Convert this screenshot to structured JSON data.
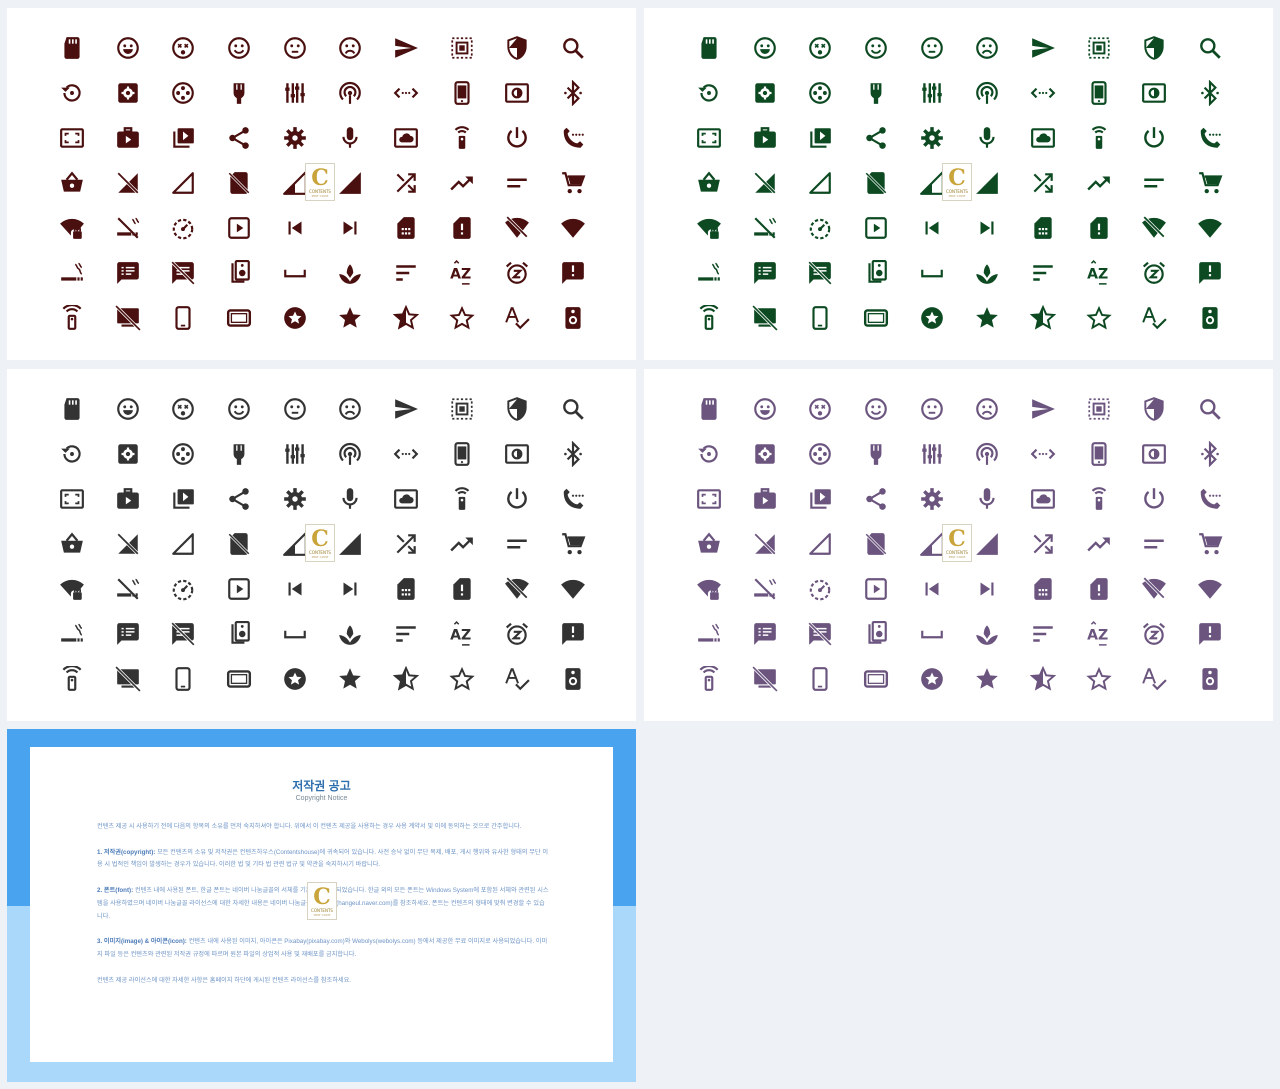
{
  "slides": [
    {
      "name": "icons-maroon",
      "color": "#4a0f0f"
    },
    {
      "name": "icons-green",
      "color": "#0d4a22"
    },
    {
      "name": "icons-charcoal",
      "color": "#333333"
    },
    {
      "name": "icons-purple",
      "color": "#6b557f"
    }
  ],
  "icon_grid": {
    "rows": [
      [
        "sd-card-icon",
        "smile-grin-icon",
        "dizzy-face-icon",
        "smile-icon",
        "neutral-face-icon",
        "sad-face-icon",
        "send-icon",
        "select-all-icon",
        "shield-icon",
        "search-icon"
      ],
      [
        "restore-icon",
        "settings-box-icon",
        "film-reel-icon",
        "power-plug-icon",
        "equalizer-icon",
        "wifi-tethering-icon",
        "code-arrows-icon",
        "smartphone-icon",
        "brightness-box-icon",
        "bluetooth-icon"
      ],
      [
        "fullscreen-box-icon",
        "video-case-icon",
        "video-library-icon",
        "share-icon",
        "gear-icon",
        "microphone-icon",
        "cloud-box-icon",
        "remote-icon",
        "power-icon",
        "call-dots-icon"
      ],
      [
        "basket-icon",
        "signal-off-icon",
        "signal-empty-icon",
        "sim-off-icon",
        "signal-half-icon",
        "signal-full-icon",
        "shuffle-icon",
        "trending-up-icon",
        "short-text-icon",
        "cart-icon"
      ],
      [
        "wifi-lock-icon",
        "no-smoking-icon",
        "timer-dial-icon",
        "slideshow-icon",
        "skip-previous-icon",
        "skip-next-icon",
        "sim-card-icon",
        "sim-alert-icon",
        "wifi-off-icon",
        "wifi-full-icon"
      ],
      [
        "smoking-icon",
        "message-list-icon",
        "comment-off-icon",
        "speaker-group-icon",
        "space-bar-icon",
        "spa-icon",
        "sort-lines-icon",
        "sort-az-icon",
        "snooze-alarm-icon",
        "feedback-icon"
      ],
      [
        "tower-icon",
        "desktop-off-icon",
        "phone-outline-icon",
        "tablet-landscape-icon",
        "stars-icon",
        "star-icon",
        "star-half-icon",
        "star-outline-icon",
        "spellcheck-icon",
        "speaker-icon"
      ]
    ]
  },
  "watermark": {
    "letter": "C",
    "text": "CONTENTS",
    "sub": "PPAT CODE"
  },
  "notice": {
    "title": "저작권 공고",
    "subtitle": "Copyright Notice",
    "intro": "컨텐츠 제공 시 사용하기 전에 다음의 항목의 소유를 먼저 숙지하셔야 합니다. 위에서 이 컨텐츠 제공을 사용하는 경우 사용 계약서 및 이에 동의하는 것으로 간주합니다.",
    "p1_head": "1. 저작권(copyright):",
    "p1_body": "모든 컨텐츠의 소유 및 저작권은 컨텐츠하우스(Contentshouse)에 귀속되어 있습니다. 사전 승낙 없이 무단 복제, 배포, 게시 행위와 유사한 형태의 무단 이용 시 법적인 책임이 발생하는 경우가 있습니다. 이러한 법 및 기타 법 관련 법규 및 약관을 숙지하시기 바랍니다.",
    "p2_head": "2. 폰트(font):",
    "p2_body": "컨텐츠 내에 사용된 폰트, 한글 폰트는 네이버 나눔글꼴의 서체를 기본으로 사용되었습니다. 한글 외의 모든 폰트는 Windows System에 포함된 서체와 관련된 시스템을 사용하였으며 네이버 나눔글꼴 라이선스에 대한 자세한 내용은 네이버 나눔글꼴 홈페이지(hangeul.naver.com)를 참조하세요. 폰트는 컨텐츠의 형태에 맞춰 변경할 수 있습니다.",
    "p3_head": "3. 이미지(image) & 아이콘(icon):",
    "p3_body": "컨텐츠 내에 사용된 이미지, 아이콘은 Pixabay(pixabay.com)와 Webolys(webolys.com) 등에서 제공한 무료 이미지로 사용되었습니다. 이미지 파일 등은 컨텐츠와 관련된 저작권 규정에 따르며 원본 파일의 상업적 사용 및 재배포를 금지합니다.",
    "closing": "컨텐츠 제공 라이선스에 대한 자세한 사항은 홈페이지 하단에 게시된 컨텐츠 라이선스를 참조하세요."
  }
}
